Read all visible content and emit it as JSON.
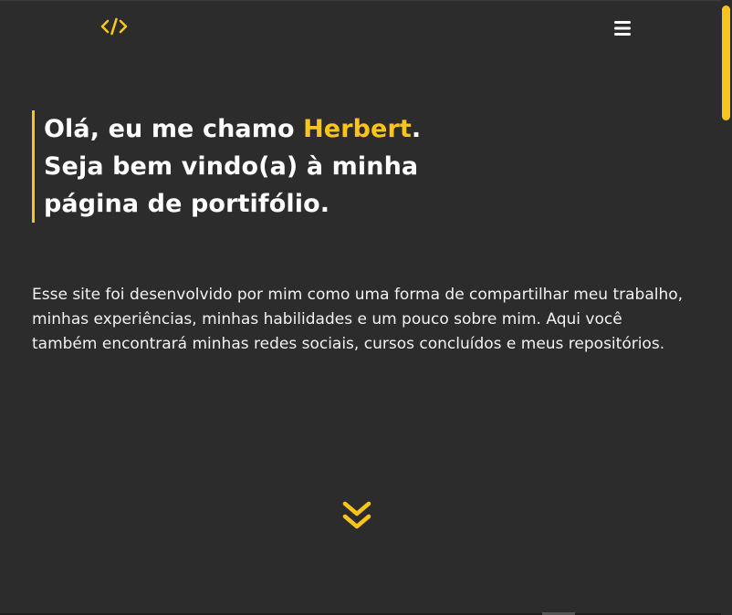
{
  "header": {
    "logo_icon": "code-brackets-icon",
    "menu_icon": "hamburger-menu-icon",
    "accent_color": "#f9c41c"
  },
  "hero": {
    "line1_prefix": "Olá, eu me chamo ",
    "line1_name": "Herbert",
    "line1_suffix": ".",
    "line2": "Seja bem vindo(a) à minha",
    "line3": "página de portifólio."
  },
  "description": "Esse site foi desenvolvido por mim como uma forma de compartilhar meu trabalho, minhas experiências, minhas habilidades e um pouco sobre mim. Aqui você também encontrará minhas redes sociais, cursos concluídos e meus repositórios.",
  "scroll_down": {
    "icon": "double-chevron-down-icon"
  },
  "colors": {
    "background": "#2c2c2c",
    "text": "#ffffff",
    "accent": "#f9c41c"
  }
}
